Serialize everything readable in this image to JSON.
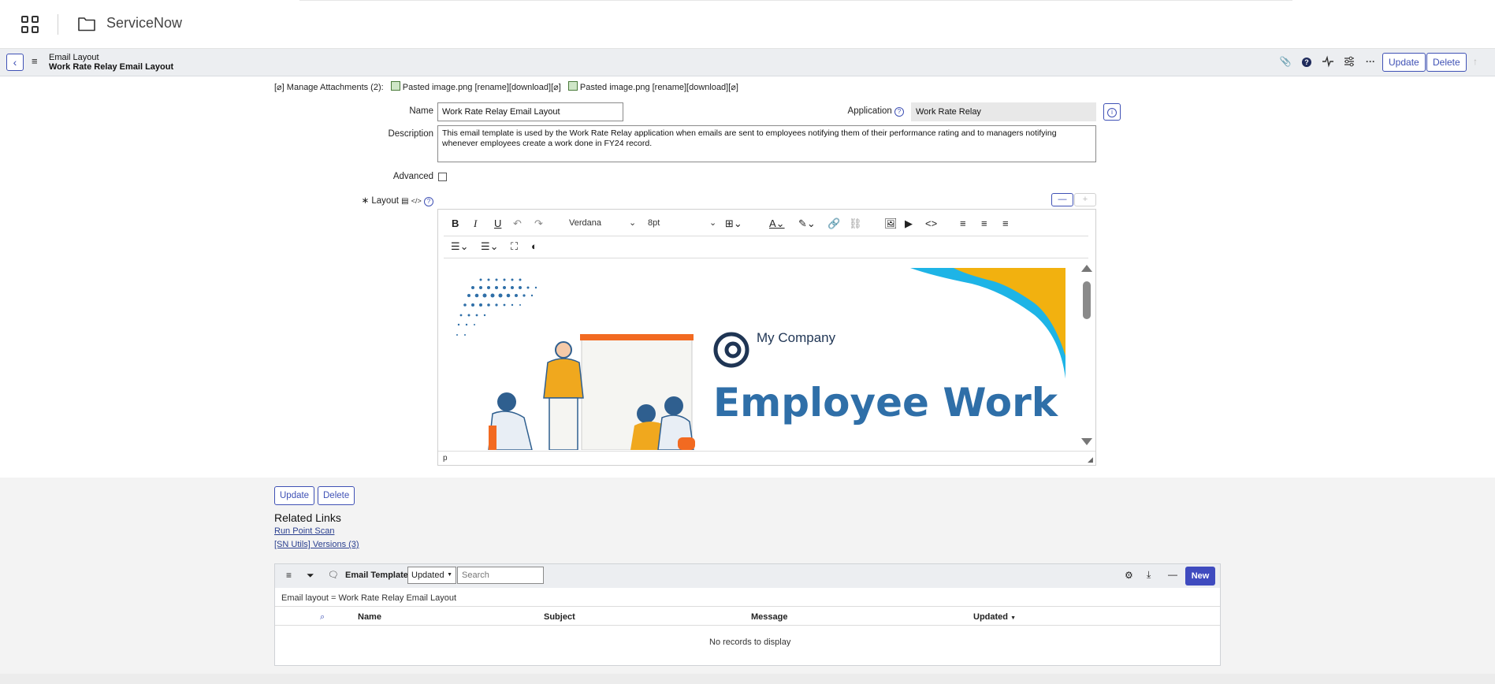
{
  "topbar": {
    "app_name": "ServiceNow"
  },
  "form_header": {
    "table_label": "Email Layout",
    "record_label": "Work Rate Relay Email Layout",
    "update_label": "Update",
    "delete_label": "Delete",
    "back_icon": "chevron-left-icon",
    "icons": [
      "paperclip-icon",
      "help-icon",
      "activity-icon",
      "sliders-icon",
      "more-icon"
    ]
  },
  "attachments": {
    "prefix": "[⌀] Manage Attachments (2):",
    "items": [
      "Pasted image.png [rename][download][⌀]",
      "Pasted image.png [rename][download][⌀]"
    ]
  },
  "fields": {
    "name_label": "Name",
    "name_value": "Work Rate Relay Email Layout",
    "application_label": "Application",
    "application_value": "Work Rate Relay",
    "description_label": "Description",
    "description_value": "This email template is used by the Work Rate Relay application when emails are sent to employees notifying them of their performance rating and to managers notifying whenever employees create a work done in FY24 record.",
    "advanced_label": "Advanced",
    "advanced_checked": false,
    "layout_label": "Layout",
    "layout_mandatory_mark": "∗"
  },
  "editor": {
    "font_family": "Verdana",
    "font_size": "8pt",
    "status_path": "p",
    "collapse_label": "—",
    "expand_label": "+",
    "content": {
      "company_name": "My Company",
      "headline": "Employee Work"
    }
  },
  "bottom_buttons": {
    "update_label": "Update",
    "delete_label": "Delete"
  },
  "related_links": {
    "title": "Related Links",
    "links": [
      "Run Point Scan",
      "[SN Utils] Versions (3)"
    ]
  },
  "related_list": {
    "title": "Email Templates",
    "sort_select": "Updated",
    "search_placeholder": "Search",
    "new_label": "New",
    "filter_text": "Email layout = Work Rate Relay Email Layout",
    "columns": [
      "Name",
      "Subject",
      "Message",
      "Updated"
    ],
    "sort_indicator": "▼",
    "empty_text": "No records to display"
  },
  "colors": {
    "accent": "#3f51b5",
    "new_button": "#3f4bbf",
    "header_bg": "#eceef1"
  }
}
